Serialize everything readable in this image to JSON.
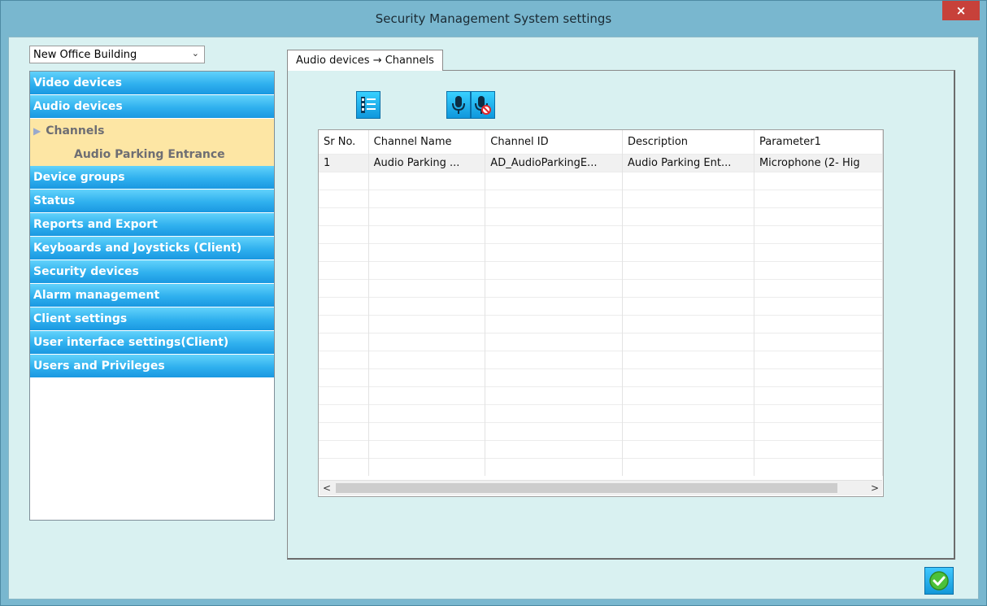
{
  "window": {
    "title": "Security Management System settings",
    "close_glyph": "×"
  },
  "building_select": {
    "value": "New Office Building",
    "chevron": "⌄"
  },
  "nav": {
    "items_top": [
      "Video devices",
      "Audio devices"
    ],
    "sub_channels": {
      "arrow": "▶",
      "label": "Channels"
    },
    "sub_child": "Audio Parking Entrance",
    "items_bottom": [
      "Device groups",
      "Status",
      "Reports and Export",
      "Keyboards and Joysticks (Client)",
      "Security devices",
      "Alarm management",
      "Client settings",
      "User interface settings(Client)",
      "Users and Privileges"
    ]
  },
  "tab": {
    "label": "Audio devices → Channels"
  },
  "toolbar": {
    "icons": [
      "list-icon",
      "microphone-icon",
      "microphone-disabled-icon"
    ]
  },
  "grid": {
    "columns": [
      "Sr No.",
      "Channel Name",
      "Channel ID",
      "Description",
      "Parameter1"
    ],
    "rows": [
      [
        "1",
        "Audio Parking ...",
        "AD_AudioParkingE...",
        "Audio Parking Ent...",
        "Microphone (2- Hig"
      ]
    ],
    "scroll_left": "<",
    "scroll_right": ">"
  },
  "colors": {
    "nav_accent": "#2fb0ee",
    "selected_bg": "#fde6a4",
    "close": "#c7413a"
  }
}
